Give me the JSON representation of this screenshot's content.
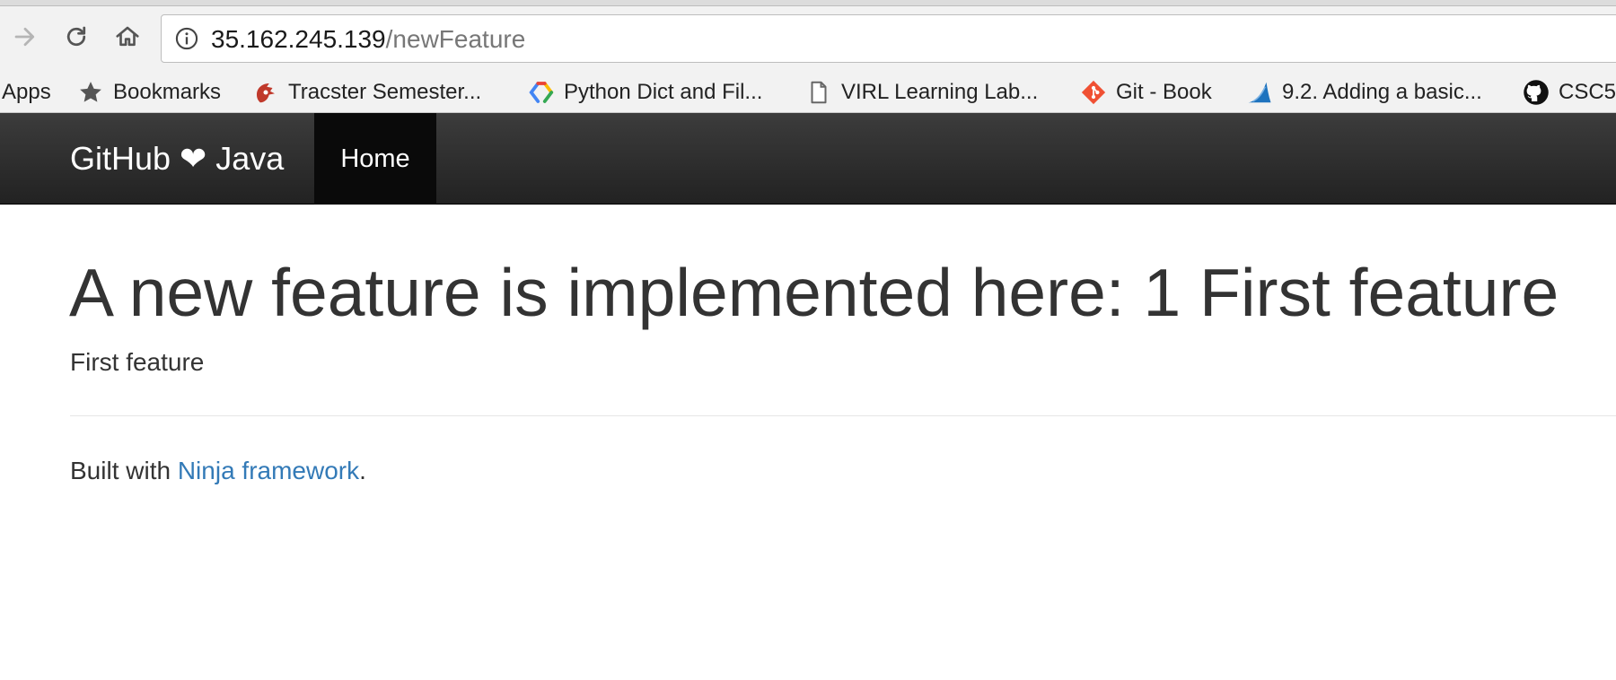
{
  "browser": {
    "url_host": "35.162.245.139",
    "url_path": "/newFeature",
    "bookmarks": [
      {
        "label": "Apps",
        "icon": "apps-icon"
      },
      {
        "label": "Bookmarks",
        "icon": "star-icon"
      },
      {
        "label": "Tracster Semester...",
        "icon": "tracster-icon"
      },
      {
        "label": "Python Dict and Fil...",
        "icon": "google-drive-icon"
      },
      {
        "label": "VIRL Learning Lab...",
        "icon": "document-icon"
      },
      {
        "label": "Git - Book",
        "icon": "git-icon"
      },
      {
        "label": "9.2. Adding a basic...",
        "icon": "wireshark-icon"
      },
      {
        "label": "CSC5",
        "icon": "github-icon"
      }
    ]
  },
  "navbar": {
    "brand": "GitHub ❤ Java",
    "home_label": "Home"
  },
  "main": {
    "heading": "A new feature is implemented here: 1 First feature",
    "description": "First feature"
  },
  "footer": {
    "prefix": "Built with ",
    "link_text": "Ninja framework",
    "suffix": "."
  },
  "colors": {
    "link": "#337ab7",
    "navbar": "#222222",
    "active_nav": "#0a0a0a"
  }
}
